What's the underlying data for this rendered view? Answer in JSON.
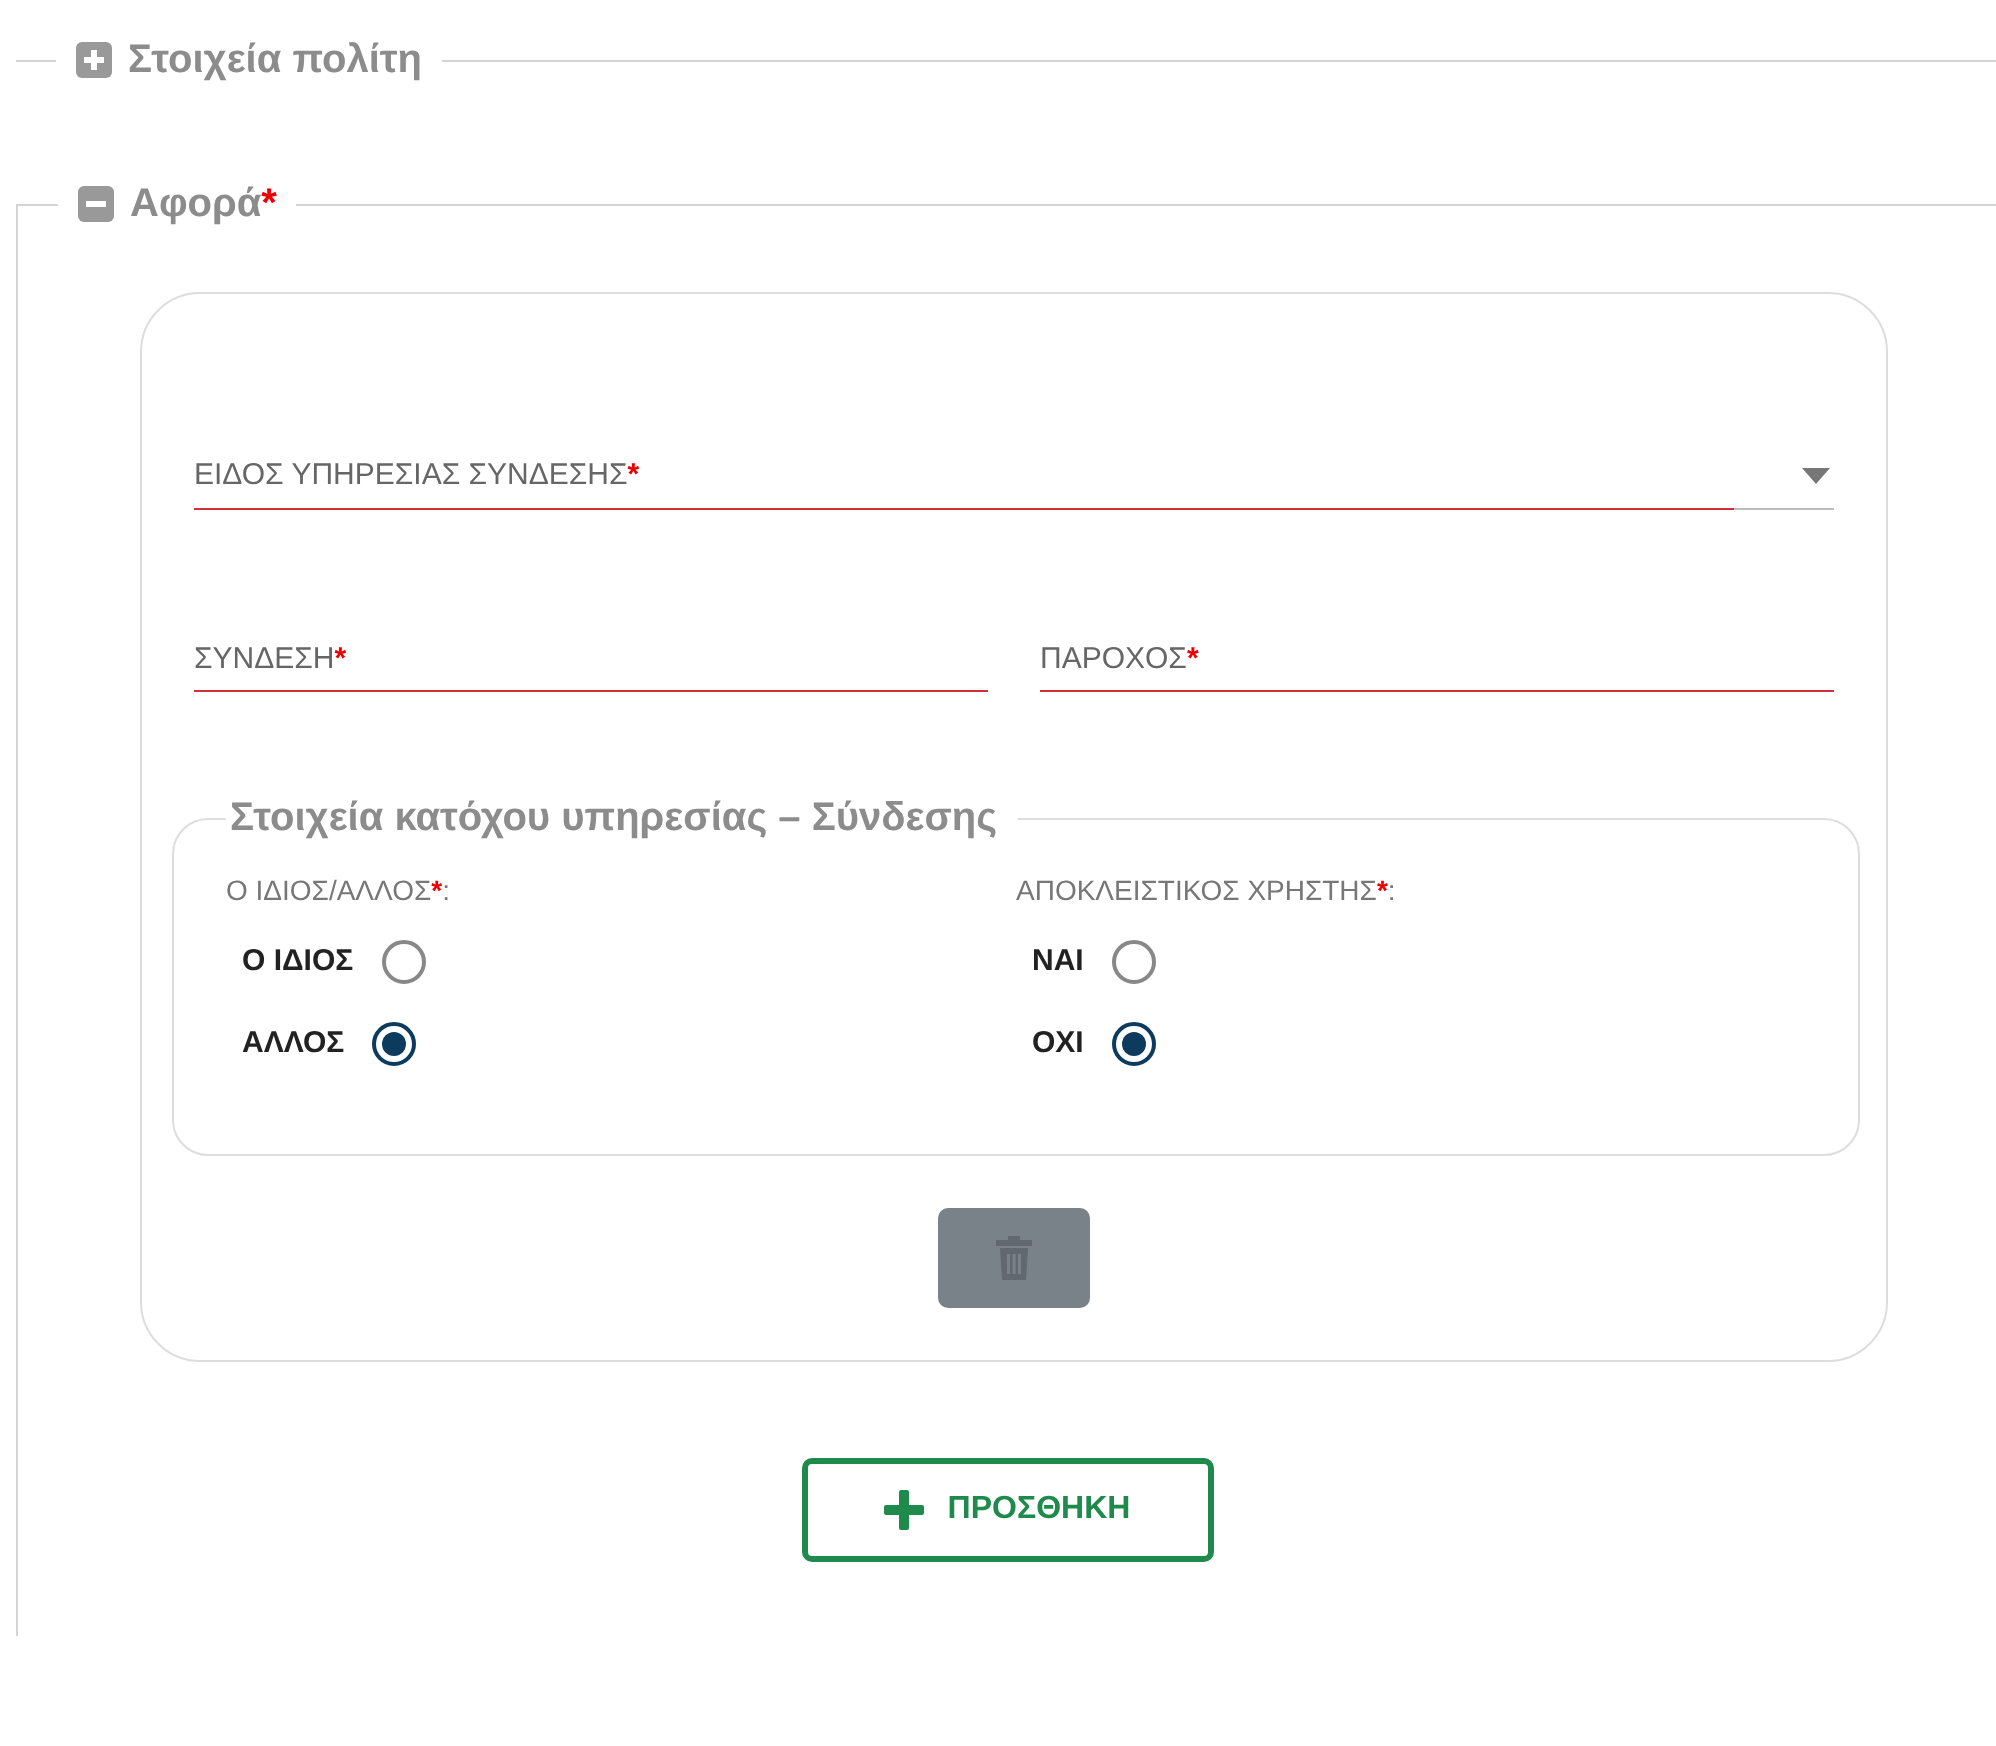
{
  "sections": [
    {
      "title": "Στοιχεία πολίτη",
      "expanded": false
    },
    {
      "title": "Αφορά",
      "expanded": true,
      "required_mark": "*",
      "card": {
        "select_field": {
          "label": "ΕΙΔΟΣ ΥΠΗΡΕΣΙΑΣ ΣΥΝΔΕΣΗΣ",
          "required_mark": "*",
          "invalid": true
        },
        "fields": [
          {
            "label": "ΣΥΝΔΕΣΗ",
            "required_mark": "*",
            "invalid": true
          },
          {
            "label": "ΠΑΡΟΧΟΣ",
            "required_mark": "*",
            "invalid": true
          }
        ],
        "group": {
          "title": "Στοιχεία κατόχου υπηρεσίας – Σύνδεσης",
          "radio_groups": [
            {
              "label": "Ο ΙΔΙΟΣ/ΑΛΛΟΣ",
              "required_mark": "*",
              "suffix": ":",
              "options": [
                {
                  "label": "Ο ΙΔΙΟΣ",
                  "selected": false
                },
                {
                  "label": "ΑΛΛΟΣ",
                  "selected": true
                }
              ]
            },
            {
              "label": "ΑΠΟΚΛΕΙΣΤΙΚΟΣ ΧΡΗΣΤΗΣ",
              "required_mark": "*",
              "suffix": ":",
              "options": [
                {
                  "label": "ΝΑΙ",
                  "selected": false
                },
                {
                  "label": "ΟΧΙ",
                  "selected": true
                }
              ]
            }
          ]
        },
        "delete_button": {
          "disabled": true
        }
      },
      "add_button": {
        "label": "ΠΡΟΣΘΗΚΗ"
      }
    }
  ]
}
